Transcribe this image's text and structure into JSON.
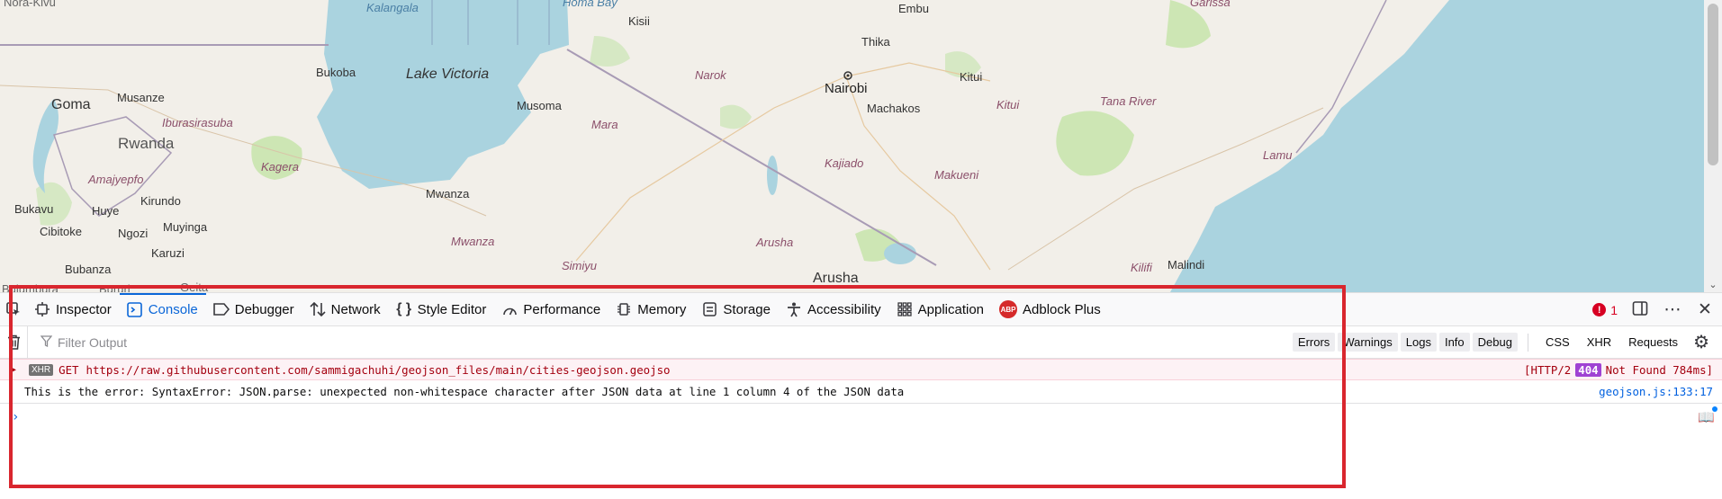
{
  "map": {
    "labels": {
      "nora_kivu": "Nora-Kivu",
      "kalangala": "Kalangala",
      "homa_bay": "Homa Bay",
      "embu": "Embu",
      "garissa": "Garissa",
      "kisii": "Kisii",
      "thika": "Thika",
      "bukoba": "Bukoba",
      "lake_victoria": "Lake Victoria",
      "narok": "Narok",
      "nairobi": "Nairobi",
      "kitui_town": "Kitui",
      "goma": "Goma",
      "musanze": "Musanze",
      "musoma": "Musoma",
      "machakos": "Machakos",
      "kitui_region": "Kitui",
      "tana_river": "Tana River",
      "iburasirasuba": "Iburasirasuba",
      "rwanda": "Rwanda",
      "mara": "Mara",
      "lamu": "Lamu",
      "kagera": "Kagera",
      "kajiado": "Kajiado",
      "makueni": "Makueni",
      "amajyepfo": "Amajyepfo",
      "mwanza": "Mwanza",
      "bukavu": "Bukavu",
      "huye": "Huye",
      "kirundo": "Kirundo",
      "cibitoke": "Cibitoke",
      "ngozi": "Ngozi",
      "muyinga": "Muyinga",
      "mwanza_region": "Mwanza",
      "arusha_region": "Arusha",
      "karuzi": "Karuzi",
      "kilifi": "Kilifi",
      "malindi": "Malindi",
      "simiyu": "Simiyu",
      "bubanza": "Bubanza",
      "arusha": "Arusha",
      "bujumbura": "Bujumbura",
      "bururi": "Bururi",
      "geita": "Geita"
    },
    "colors": {
      "land": "#f2efe9",
      "water": "#aad3df",
      "park": "#cde6b4",
      "border": "#a89bb5"
    }
  },
  "devtools": {
    "tabs": [
      {
        "label": "Inspector",
        "icon": "inspector-icon"
      },
      {
        "label": "Console",
        "icon": "console-icon"
      },
      {
        "label": "Debugger",
        "icon": "debugger-icon"
      },
      {
        "label": "Network",
        "icon": "network-icon"
      },
      {
        "label": "Style Editor",
        "icon": "style-editor-icon"
      },
      {
        "label": "Performance",
        "icon": "performance-icon"
      },
      {
        "label": "Memory",
        "icon": "memory-icon"
      },
      {
        "label": "Storage",
        "icon": "storage-icon"
      },
      {
        "label": "Accessibility",
        "icon": "accessibility-icon"
      },
      {
        "label": "Application",
        "icon": "application-icon"
      },
      {
        "label": "Adblock Plus",
        "icon": "adblock-plus-icon"
      }
    ],
    "abp_text": "ABP",
    "error_count": "1",
    "error_mark": "!",
    "filter_placeholder": "Filter Output",
    "levels": [
      "Errors",
      "Warnings",
      "Logs",
      "Info",
      "Debug"
    ],
    "filters": [
      "CSS",
      "XHR",
      "Requests"
    ],
    "messages": {
      "xhr_tag": "XHR",
      "method": "GET",
      "url": "https://raw.githubusercontent.com/sammigachuhi/geojson_files/main/cities-geojson.geojso",
      "status_prefix": "[HTTP/2",
      "status_code": "404",
      "status_suffix": "Not Found 784ms]",
      "log_text": "This is the error: SyntaxError: JSON.parse: unexpected non-whitespace character after JSON data at line 1 column 4 of the JSON data",
      "log_source": "geojson.js:133:17"
    },
    "accent": "#0a66d8",
    "error_color": "#d70022",
    "highlight_color": "#d9262e"
  }
}
